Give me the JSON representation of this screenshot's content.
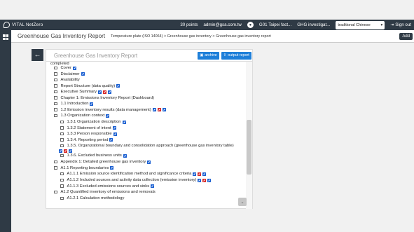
{
  "app": {
    "brand": "VITAL NetZero"
  },
  "topbar": {
    "points": "30 points",
    "user": "admin@gsa.com.tw",
    "org": "G01 Taipei fact...",
    "project": "GHG investigat...",
    "language": "traditional Chinese",
    "signout": "Sign out"
  },
  "header": {
    "title": "Greenhouse Gas Inventory Report",
    "breadcrumb": "Temperature plate (ISO 14064) > Greenhouse gas inventory > Greenhouse gas inventory report",
    "add_label": "Add"
  },
  "panel": {
    "title": "Greenhouse Gas Inventory Report",
    "archive_label": "archive",
    "output_label": "output report",
    "completed_label": "completed"
  },
  "items": [
    {
      "label": "Cover",
      "edit": [
        "blue"
      ]
    },
    {
      "label": "Disclaimer",
      "edit": [
        "blue"
      ]
    },
    {
      "label": "Availability",
      "edit": []
    },
    {
      "label": "Report Structure (data quality)",
      "edit": [
        "blue"
      ]
    },
    {
      "label": "Executive Summary",
      "edit": [
        "blue",
        "red",
        "blue"
      ]
    },
    {
      "label": "Chapter 1: Emissions Inventory Report (Dashboard)",
      "edit": []
    },
    {
      "label": "1.1 Introduction",
      "edit": [
        "blue"
      ]
    },
    {
      "label": "1.2 Emission inventory results (data management)",
      "edit": [
        "blue",
        "red",
        "blue"
      ]
    },
    {
      "label": "1.3 Organization context",
      "edit": [
        "blue"
      ]
    },
    {
      "label": "1.3.1 Organization description",
      "edit": [
        "blue"
      ]
    },
    {
      "label": "1.3.2 Statement of intent",
      "edit": [
        "blue"
      ]
    },
    {
      "label": "1.3.3 Person responsible",
      "edit": [
        "blue"
      ]
    },
    {
      "label": "1.3.4. Reporting period",
      "edit": [
        "blue"
      ]
    },
    {
      "label": "1.3.5. Organizational boundary and consolidation approach (greenhouse gas inventory table)",
      "edit": [
        "blue",
        "red",
        "blue"
      ]
    },
    {
      "label": "1.3.6. Excluded business units",
      "edit": [
        "blue"
      ]
    },
    {
      "label": "Appendix 1: Detailed greenhouse gas inventory",
      "edit": [
        "blue"
      ]
    },
    {
      "label": "A1.1 Reporting boundaries",
      "edit": [
        "blue"
      ]
    },
    {
      "label": "A1.1.1 Emission source identification method and significance criteria",
      "edit": [
        "blue",
        "red",
        "blue"
      ]
    },
    {
      "label": "A1.1.2 Included sources and activity data collection (emission inventory)",
      "edit": [
        "blue",
        "red",
        "blue"
      ]
    },
    {
      "label": "A1.1.3 Excluded emissions sources and sinks",
      "edit": [
        "blue"
      ]
    },
    {
      "label": "A1.2 Quantified inventory of emissions and removals",
      "edit": []
    },
    {
      "label": "A1.2.1 Calculation methodology",
      "edit": []
    }
  ]
}
